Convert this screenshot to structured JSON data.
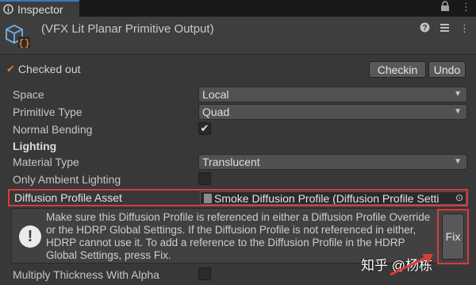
{
  "tab": {
    "label": "Inspector"
  },
  "header": {
    "title": "(VFX Lit Planar Primitive Output)"
  },
  "vcs": {
    "status": "Checked out",
    "checkin_label": "Checkin",
    "undo_label": "Undo"
  },
  "properties": {
    "space": {
      "label": "Space",
      "value": "Local"
    },
    "primitive_type": {
      "label": "Primitive Type",
      "value": "Quad"
    },
    "normal_bending": {
      "label": "Normal Bending",
      "checked": true
    },
    "lighting_header": "Lighting",
    "material_type": {
      "label": "Material Type",
      "value": "Translucent"
    },
    "only_ambient": {
      "label": "Only Ambient Lighting",
      "checked": false
    },
    "diffusion_profile": {
      "label": "Diffusion Profile Asset",
      "value": "Smoke Diffusion Profile (Diffusion Profile Setti"
    },
    "multiply_thickness": {
      "label": "Multiply Thickness With Alpha",
      "checked": false
    }
  },
  "helpbox": {
    "message": "Make sure this Diffusion Profile is referenced in either a Diffusion Profile Override or the HDRP Global Settings. If the Diffusion Profile is not referenced in either, HDRP cannot use it. To add a reference to the Diffusion Profile in the HDRP Global Settings, press Fix.",
    "fix_label": "Fix"
  },
  "watermark": "知乎 @杨栋",
  "colors": {
    "highlight": "#d83c3c",
    "accent": "#e07b30"
  }
}
